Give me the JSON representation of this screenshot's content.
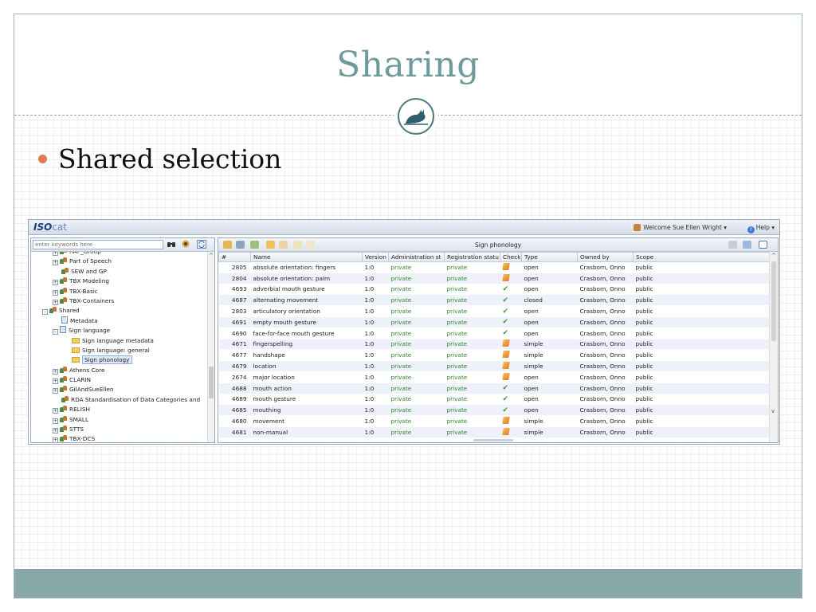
{
  "slide": {
    "title": "Sharing",
    "bullet": "Shared selection"
  },
  "colors": {
    "title": "#6e9b99",
    "bullet_dot": "#e07b56",
    "footer": "#88a8a8",
    "status_green": "#2e8a2e"
  },
  "app": {
    "logo_iso": "ISO",
    "logo_cat": "cat",
    "welcome": "Welcome Sue Ellen Wright ▾",
    "help": "Help ▾",
    "search_placeholder": "enter keywords here",
    "tree": [
      {
        "label": "RAF_Group",
        "icon": "group-icon",
        "indent": 1,
        "expander": "+"
      },
      {
        "label": "Part of Speech",
        "icon": "group-icon",
        "indent": 1,
        "expander": "+"
      },
      {
        "label": "SEW and GP",
        "icon": "group-icon",
        "indent": 1,
        "expander": ""
      },
      {
        "label": "TBX Modeling",
        "icon": "group-icon",
        "indent": 1,
        "expander": "+"
      },
      {
        "label": "TBX-Basic",
        "icon": "group-icon",
        "indent": 1,
        "expander": "+"
      },
      {
        "label": "TBX-Containers",
        "icon": "group-icon",
        "indent": 1,
        "expander": "+"
      },
      {
        "label": "Shared",
        "icon": "group-icon",
        "indent": 0,
        "expander": "−"
      },
      {
        "label": "Metadata",
        "icon": "document-icon",
        "indent": 1,
        "expander": ""
      },
      {
        "label": "Sign language",
        "icon": "document-icon",
        "indent": 1,
        "expander": "−"
      },
      {
        "label": "Sign language metadata",
        "icon": "folder-icon",
        "indent": 2,
        "expander": ""
      },
      {
        "label": "Sign language: general",
        "icon": "folder-icon",
        "indent": 2,
        "expander": ""
      },
      {
        "label": "Sign phonology",
        "icon": "folder-icon",
        "indent": 2,
        "expander": "",
        "selected": true
      },
      {
        "label": "Athens Core",
        "icon": "group-icon",
        "indent": 1,
        "expander": "+"
      },
      {
        "label": "CLARIN",
        "icon": "group-icon",
        "indent": 1,
        "expander": "+"
      },
      {
        "label": "GilAndSueEllen",
        "icon": "group-icon",
        "indent": 1,
        "expander": "+"
      },
      {
        "label": "RDA Standardisation of Data Categories and",
        "icon": "group-icon",
        "indent": 1,
        "expander": ""
      },
      {
        "label": "RELISH",
        "icon": "group-icon",
        "indent": 1,
        "expander": "+"
      },
      {
        "label": "SMALL",
        "icon": "group-icon",
        "indent": 1,
        "expander": "+"
      },
      {
        "label": "STTS",
        "icon": "group-icon",
        "indent": 1,
        "expander": "+"
      },
      {
        "label": "TBX-DCS",
        "icon": "group-icon",
        "indent": 1,
        "expander": "+"
      }
    ],
    "panel_title": "Sign phonology",
    "columns": [
      "#",
      "Name",
      "Version",
      "Administration st",
      "Registration statu",
      "Check",
      "Type",
      "Owned by",
      "Scope"
    ],
    "rows": [
      {
        "id": "2805",
        "name": "absolute orientation: fingers",
        "version": "1:0",
        "admin": "private",
        "reg": "private",
        "check": "warn",
        "type": "open",
        "owner": "Crasborn, Onno",
        "scope": "public"
      },
      {
        "id": "2804",
        "name": "absolute orientation: palm",
        "version": "1:0",
        "admin": "private",
        "reg": "private",
        "check": "warn",
        "type": "open",
        "owner": "Crasborn, Onno",
        "scope": "public"
      },
      {
        "id": "4693",
        "name": "adverbial mouth gesture",
        "version": "1:0",
        "admin": "private",
        "reg": "private",
        "check": "ok",
        "type": "open",
        "owner": "Crasborn, Onno",
        "scope": "public"
      },
      {
        "id": "4687",
        "name": "alternating movement",
        "version": "1:0",
        "admin": "private",
        "reg": "private",
        "check": "ok",
        "type": "closed",
        "owner": "Crasborn, Onno",
        "scope": "public"
      },
      {
        "id": "2803",
        "name": "articulatory orientation",
        "version": "1:0",
        "admin": "private",
        "reg": "private",
        "check": "ok",
        "type": "open",
        "owner": "Crasborn, Onno",
        "scope": "public"
      },
      {
        "id": "4691",
        "name": "empty mouth gesture",
        "version": "1:0",
        "admin": "private",
        "reg": "private",
        "check": "ok",
        "type": "open",
        "owner": "Crasborn, Onno",
        "scope": "public"
      },
      {
        "id": "4690",
        "name": "face-for-face mouth gesture",
        "version": "1:0",
        "admin": "private",
        "reg": "private",
        "check": "ok",
        "type": "open",
        "owner": "Crasborn, Onno",
        "scope": "public"
      },
      {
        "id": "4671",
        "name": "fingerspelling",
        "version": "1:0",
        "admin": "private",
        "reg": "private",
        "check": "warn",
        "type": "simple",
        "owner": "Crasborn, Onno",
        "scope": "public"
      },
      {
        "id": "4677",
        "name": "handshape",
        "version": "1:0",
        "admin": "private",
        "reg": "private",
        "check": "warn",
        "type": "simple",
        "owner": "Crasborn, Onno",
        "scope": "public"
      },
      {
        "id": "4679",
        "name": "location",
        "version": "1:0",
        "admin": "private",
        "reg": "private",
        "check": "warn",
        "type": "simple",
        "owner": "Crasborn, Onno",
        "scope": "public"
      },
      {
        "id": "2674",
        "name": "major location",
        "version": "1:0",
        "admin": "private",
        "reg": "private",
        "check": "warn",
        "type": "open",
        "owner": "Crasborn, Onno",
        "scope": "public"
      },
      {
        "id": "4688",
        "name": "mouth action",
        "version": "1:0",
        "admin": "private",
        "reg": "private",
        "check": "ok",
        "type": "open",
        "owner": "Crasborn, Onno",
        "scope": "public"
      },
      {
        "id": "4689",
        "name": "mouth gesture",
        "version": "1:0",
        "admin": "private",
        "reg": "private",
        "check": "ok",
        "type": "open",
        "owner": "Crasborn, Onno",
        "scope": "public"
      },
      {
        "id": "4685",
        "name": "mouthing",
        "version": "1:0",
        "admin": "private",
        "reg": "private",
        "check": "ok",
        "type": "open",
        "owner": "Crasborn, Onno",
        "scope": "public"
      },
      {
        "id": "4680",
        "name": "movement",
        "version": "1:0",
        "admin": "private",
        "reg": "private",
        "check": "warn",
        "type": "simple",
        "owner": "Crasborn, Onno",
        "scope": "public"
      },
      {
        "id": "4681",
        "name": "non-manual",
        "version": "1:0",
        "admin": "private",
        "reg": "private",
        "check": "warn",
        "type": "simple",
        "owner": "Crasborn, Onno",
        "scope": "public"
      }
    ]
  }
}
